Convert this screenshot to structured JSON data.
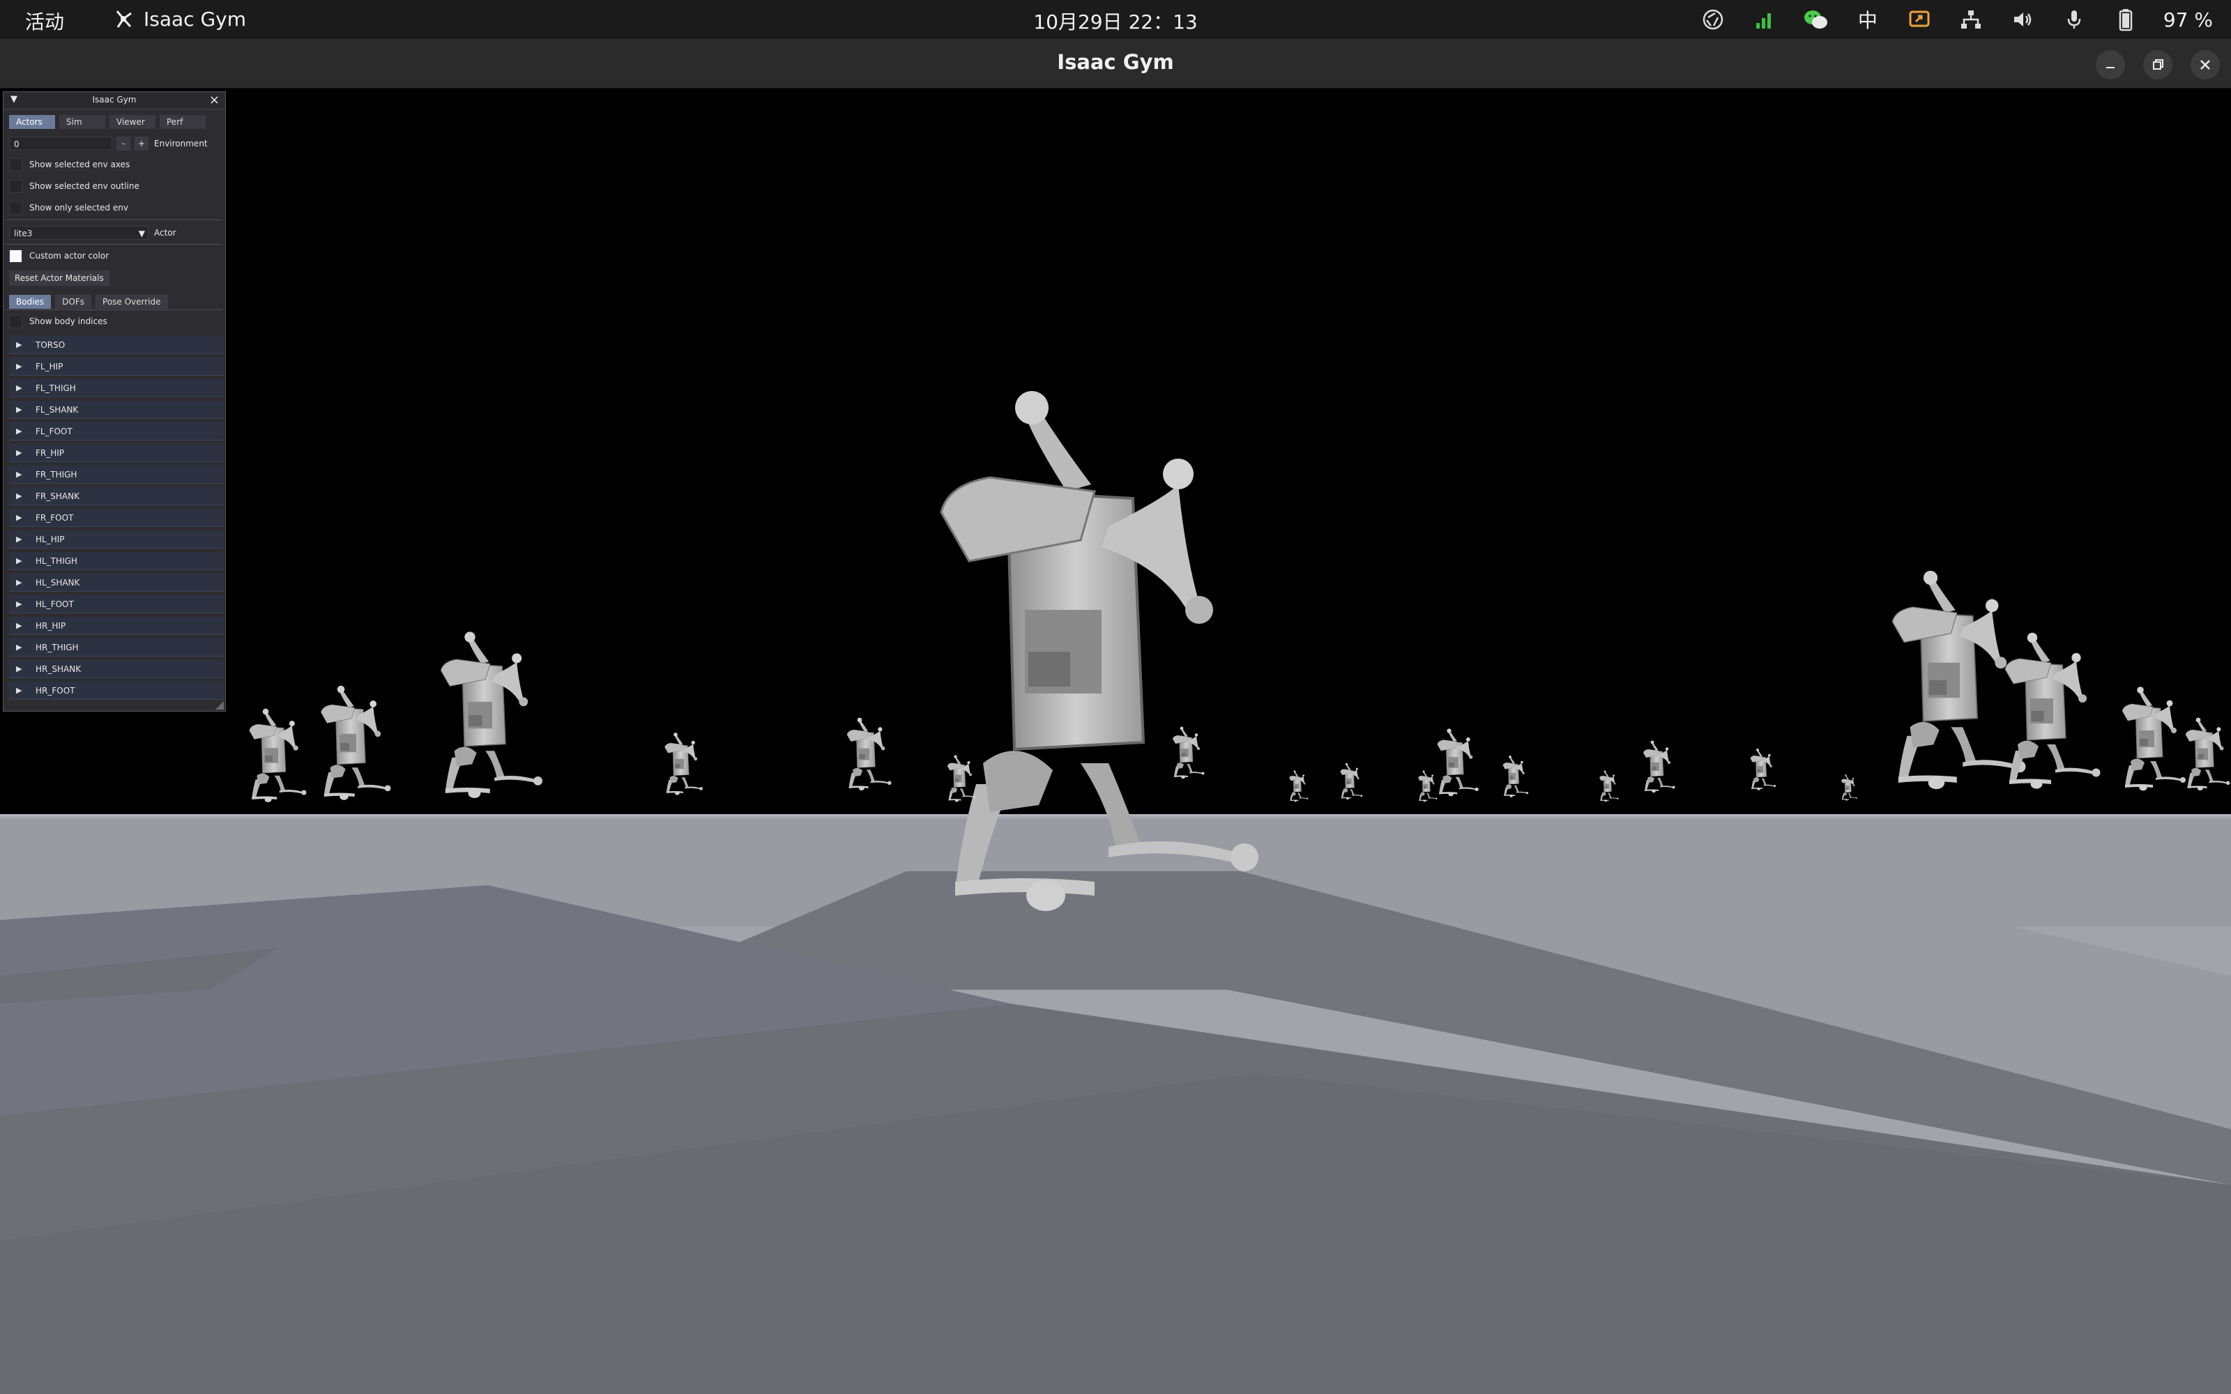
{
  "topbar": {
    "activities": "活动",
    "app_name": "Isaac Gym",
    "clock": "10月29日  22：13",
    "tray": {
      "icons": [
        "screencast-icon",
        "network-signal-icon",
        "wechat-icon",
        "input-method-icon",
        "screen-share-icon",
        "network-wired-icon",
        "volume-icon",
        "microphone-icon",
        "battery-icon"
      ],
      "input_method": "中",
      "battery_percent": "97 %"
    }
  },
  "window": {
    "title": "Isaac Gym",
    "controls": [
      "minimize",
      "maximize",
      "close"
    ]
  },
  "panel": {
    "title": "Isaac Gym",
    "tabs": [
      {
        "label": "Actors",
        "active": true
      },
      {
        "label": "Sim",
        "active": false
      },
      {
        "label": "Viewer",
        "active": false
      },
      {
        "label": "Perf",
        "active": false
      }
    ],
    "environment": {
      "value": "0",
      "minus": "-",
      "plus": "+",
      "label": "Environment"
    },
    "options": [
      {
        "label": "Show selected env axes",
        "checked": false
      },
      {
        "label": "Show selected env outline",
        "checked": false
      },
      {
        "label": "Show only selected env",
        "checked": false
      }
    ],
    "actor": {
      "value": "lite3",
      "label": "Actor"
    },
    "custom_color": {
      "label": "Custom actor color"
    },
    "reset_button": "Reset Actor Materials",
    "sub_tabs": [
      {
        "label": "Bodies",
        "active": true
      },
      {
        "label": "DOFs",
        "active": false
      },
      {
        "label": "Pose Override",
        "active": false
      }
    ],
    "show_indices": {
      "label": "Show body indices",
      "checked": false
    },
    "bodies": [
      "TORSO",
      "FL_HIP",
      "FL_THIGH",
      "FL_SHANK",
      "FL_FOOT",
      "FR_HIP",
      "FR_THIGH",
      "FR_SHANK",
      "FR_FOOT",
      "HL_HIP",
      "HL_THIGH",
      "HL_SHANK",
      "HL_FOOT",
      "HR_HIP",
      "HR_THIGH",
      "HR_SHANK",
      "HR_FOOT"
    ]
  },
  "colors": {
    "sky": "#000000",
    "ground_light": "#a3a3ab",
    "ground_dark": "#6e6e76",
    "robot": "#c8c8c8",
    "panel_accent": "#6a7c9a"
  }
}
